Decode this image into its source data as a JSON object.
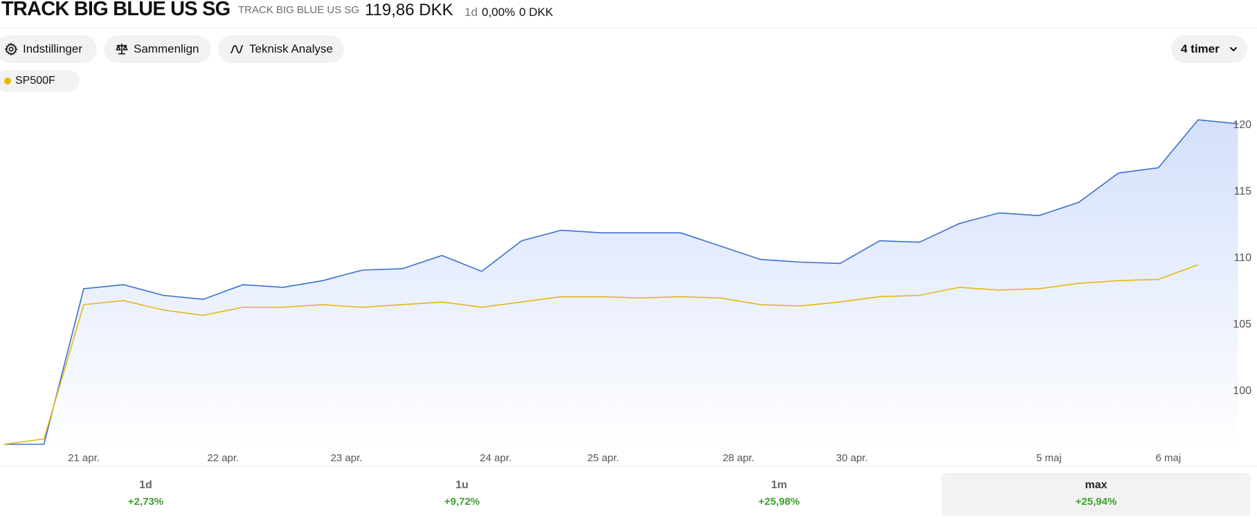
{
  "header": {
    "title": "TRACK BIG BLUE US SG",
    "subtitle": "TRACK BIG BLUE US SG",
    "price": "119,86 DKK",
    "change_period": "1d",
    "change_pct": "0,00%",
    "change_abs": "0 DKK"
  },
  "toolbar": {
    "settings_label": "Indstillinger",
    "compare_label": "Sammenlign",
    "technical_label": "Teknisk Analyse",
    "interval_label": "4 timer"
  },
  "legend": {
    "items": [
      {
        "label": "SP500F",
        "color": "#e2b818"
      }
    ]
  },
  "chart_data": {
    "type": "line",
    "y_ticks": [
      100,
      105,
      110,
      115,
      120
    ],
    "ylim": [
      95.3,
      121.5
    ],
    "x_ticks": [
      {
        "label": "21 apr.",
        "x": 2.0
      },
      {
        "label": "22 apr.",
        "x": 5.5
      },
      {
        "label": "23 apr.",
        "x": 8.6
      },
      {
        "label": "24 apr.",
        "x": 12.35
      },
      {
        "label": "25 apr.",
        "x": 15.05
      },
      {
        "label": "28 apr.",
        "x": 18.45
      },
      {
        "label": "30 apr.",
        "x": 21.3
      },
      {
        "label": "5 maj",
        "x": 26.25
      },
      {
        "label": "6 maj",
        "x": 29.25
      }
    ],
    "series": [
      {
        "color": "#3b6fd0",
        "area": true,
        "values": [
          95.9,
          95.9,
          107.6,
          107.9,
          107.1,
          106.8,
          107.9,
          107.7,
          108.2,
          109.0,
          109.1,
          110.1,
          108.9,
          111.2,
          112.0,
          111.8,
          111.8,
          111.8,
          110.8,
          109.8,
          109.6,
          109.5,
          111.2,
          111.1,
          112.5,
          113.3,
          113.1,
          114.1,
          116.3,
          116.7,
          120.3,
          120.0
        ],
        "end_x": 31
      },
      {
        "name": "SP500F",
        "color": "#e2b818",
        "area": false,
        "values": [
          95.9,
          96.3,
          106.4,
          106.7,
          106.0,
          105.6,
          106.2,
          106.2,
          106.4,
          106.2,
          106.4,
          106.6,
          106.2,
          106.6,
          107.0,
          107.0,
          106.9,
          107.0,
          106.9,
          106.4,
          106.3,
          106.6,
          107.0,
          107.1,
          107.7,
          107.5,
          107.6,
          108.0,
          108.2,
          108.3,
          109.4
        ],
        "end_x": 30
      }
    ]
  },
  "periods": [
    {
      "label": "1d",
      "change": "+2,73%",
      "active": false
    },
    {
      "label": "1u",
      "change": "+9,72%",
      "active": false
    },
    {
      "label": "1m",
      "change": "+25,98%",
      "active": false
    },
    {
      "label": "max",
      "change": "+25,94%",
      "active": true
    }
  ]
}
